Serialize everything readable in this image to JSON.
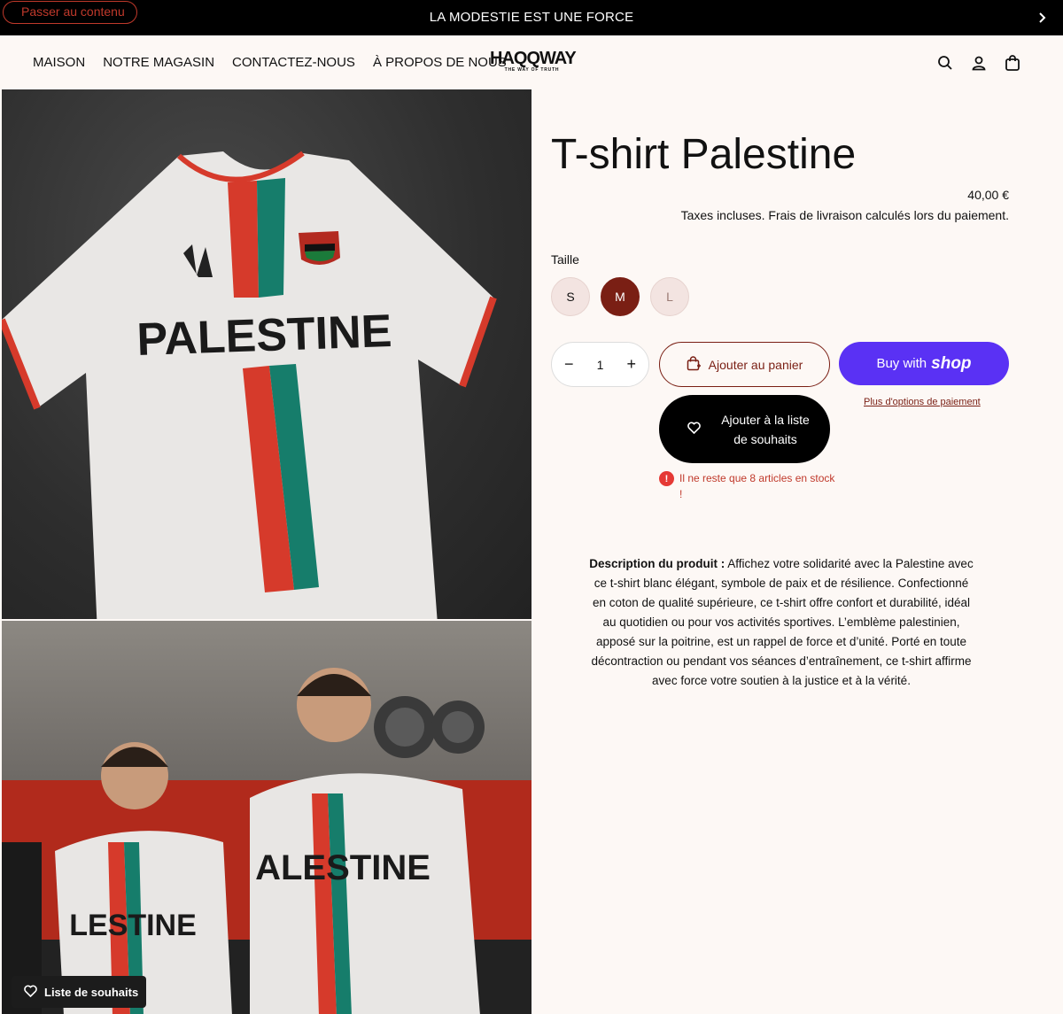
{
  "announcement": {
    "message": "LA MODESTIE EST UNE FORCE",
    "skip_link": "Passer au contenu"
  },
  "nav": {
    "items": [
      "MAISON",
      "NOTRE MAGASIN",
      "CONTACTEZ-NOUS",
      "À PROPOS DE NOUS"
    ]
  },
  "logo": {
    "word": "HAQQWAY",
    "tagline": "THE WAY OF TRUTH"
  },
  "header_icons": [
    "search-icon",
    "account-icon",
    "cart-icon"
  ],
  "product": {
    "title": "T-shirt Palestine",
    "price": "40,00 €",
    "tax_note": "Taxes incluses. Frais de livraison calculés lors du paiement.",
    "size_label": "Taille",
    "sizes": [
      "S",
      "M",
      "L"
    ],
    "selected_size": "M",
    "quantity": "1",
    "qty_minus": "−",
    "qty_plus": "+",
    "add_to_cart": "Ajouter au panier",
    "buy_with": "Buy with",
    "shop_word": "shop",
    "more_payment": "Plus d'options de paiement",
    "wishlist_add": "Ajouter à la liste de souhaits",
    "stock_warning": "Il ne reste que 8 articles en stock !",
    "description_label": "Description du produit :",
    "description": "Affichez votre solidarité avec la Palestine avec ce t-shirt blanc élégant, symbole de paix et de résilience. Confectionné en coton de qualité supérieure, ce t-shirt offre confort et durabilité, idéal au quotidien ou pour vos activités sportives. L’emblème palestinien, apposé sur la poitrine, est un rappel de force et d’unité. Porté en toute décontraction ou pendant vos séances d’entraînement, ce t-shirt affirme avec force votre soutien à la justice et à la vérité."
  },
  "gallery": {
    "shirt_print": "PALESTINE",
    "model_print_left": "LESTINE",
    "model_print_right": "ALESTINE"
  },
  "floating_wishlist": "Liste de souhaits",
  "colors": {
    "accent": "#7a1f14",
    "shop_purple": "#5a31f4",
    "background": "#fdf8f5",
    "stock_red": "#e53935"
  }
}
